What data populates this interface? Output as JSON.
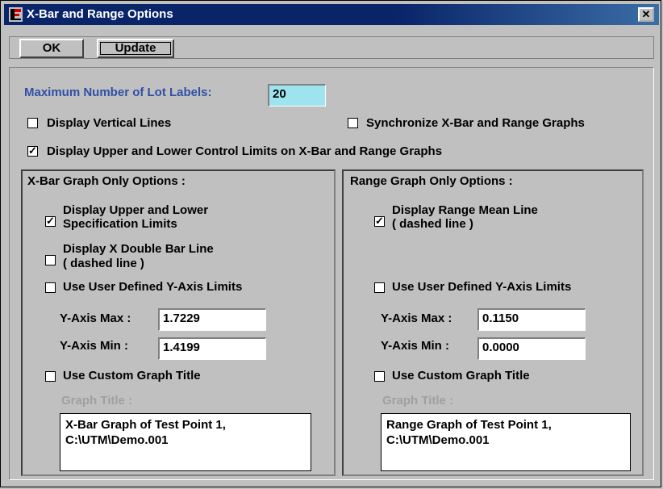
{
  "window": {
    "title": "X-Bar and Range Options",
    "app_icon": "app-icon",
    "close_icon": "close-icon",
    "close_glyph": "✕"
  },
  "toolbar": {
    "ok_label": "OK",
    "update_label": "Update"
  },
  "main": {
    "max_lot_labels_label": "Maximum Number of Lot Labels:",
    "max_lot_labels_value": "20",
    "display_vertical_lines": {
      "label": "Display Vertical Lines",
      "checked": false
    },
    "synchronize": {
      "label": "Synchronize X-Bar and Range Graphs",
      "checked": false
    },
    "display_control_limits": {
      "label": "Display Upper and Lower Control Limits on X-Bar and Range Graphs",
      "checked": true
    }
  },
  "xbar": {
    "header": "X-Bar Graph Only Options :",
    "spec_limits": {
      "line1": "Display Upper and Lower",
      "line2": "Specification Limits",
      "checked": true
    },
    "double_bar": {
      "line1": "Display X Double Bar Line",
      "line2": "( dashed line )",
      "checked": false
    },
    "user_y_limits": {
      "label": "Use User Defined Y-Axis Limits",
      "checked": false
    },
    "y_max_label": "Y-Axis Max :",
    "y_max_value": "1.7229",
    "y_min_label": "Y-Axis Min :",
    "y_min_value": "1.4199",
    "custom_title": {
      "label": "Use Custom Graph Title",
      "checked": false
    },
    "graph_title_label": "Graph Title :",
    "graph_title_line1": "X-Bar Graph of Test Point 1,",
    "graph_title_line2": "C:\\UTM\\Demo.001"
  },
  "range": {
    "header": "Range Graph Only Options :",
    "mean_line": {
      "line1": "Display Range Mean Line",
      "line2": "( dashed line )",
      "checked": true
    },
    "user_y_limits": {
      "label": "Use User Defined Y-Axis Limits",
      "checked": false
    },
    "y_max_label": "Y-Axis Max :",
    "y_max_value": "0.1150",
    "y_min_label": "Y-Axis Min :",
    "y_min_value": "0.0000",
    "custom_title": {
      "label": "Use Custom Graph Title",
      "checked": false
    },
    "graph_title_label": "Graph Title :",
    "graph_title_line1": "Range Graph of Test Point 1,",
    "graph_title_line2": "C:\\UTM\\Demo.001"
  },
  "colors": {
    "title_bar": "#0a246a",
    "label_blue": "#3050a8",
    "field_cyan": "#9ee4ee",
    "dialog_bg": "#c0c0c0"
  }
}
